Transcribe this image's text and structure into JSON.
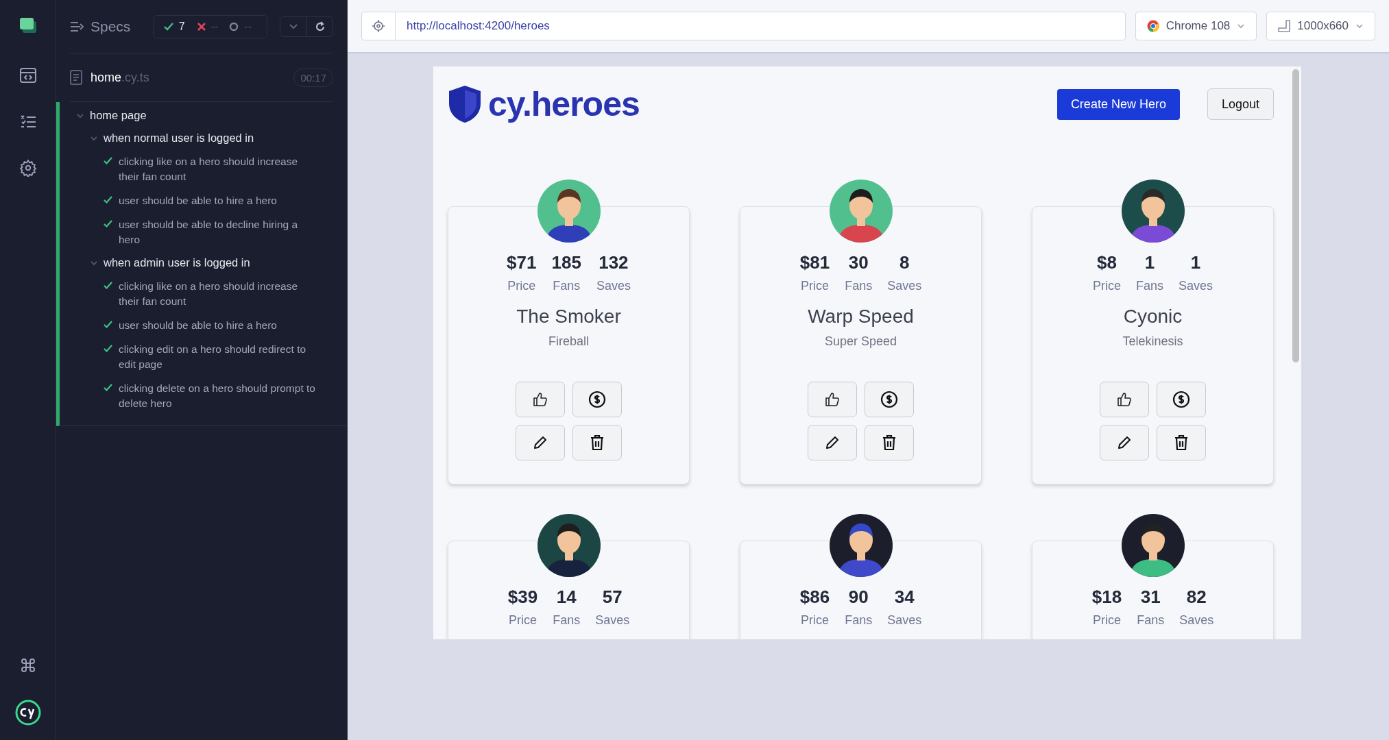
{
  "reporter": {
    "title": "Specs",
    "stats": {
      "passed": "7",
      "failed": "--",
      "pending": "--"
    },
    "spec": {
      "name": "home",
      "extension": ".cy.ts",
      "duration": "00:17"
    },
    "tree": [
      {
        "kind": "suite",
        "title": "home page",
        "expanded": true,
        "children": [
          {
            "kind": "suite",
            "title": "when normal user is logged in",
            "expanded": true,
            "children": [
              {
                "kind": "test",
                "title": "clicking like on a hero should increase their fan count",
                "passed": true
              },
              {
                "kind": "test",
                "title": "user should be able to hire a hero",
                "passed": true
              },
              {
                "kind": "test",
                "title": "user should be able to decline hiring a hero",
                "passed": true
              }
            ]
          },
          {
            "kind": "suite",
            "title": "when admin user is logged in",
            "expanded": true,
            "children": [
              {
                "kind": "test",
                "title": "clicking like on a hero should increase their fan count",
                "passed": true
              },
              {
                "kind": "test",
                "title": "user should be able to hire a hero",
                "passed": true
              },
              {
                "kind": "test",
                "title": "clicking edit on a hero should redirect to edit page",
                "passed": true
              },
              {
                "kind": "test",
                "title": "clicking delete on a hero should prompt to delete hero",
                "passed": true
              }
            ]
          }
        ]
      }
    ]
  },
  "browser_bar": {
    "url": "http://localhost:4200/heroes",
    "browser": "Chrome 108",
    "viewport": "1000x660"
  },
  "app": {
    "logo": "cy.heroes",
    "create_button": "Create New Hero",
    "logout_button": "Logout",
    "heroes": [
      {
        "color": "#52c08e",
        "stats": [
          {
            "value": "$71",
            "label": "Price"
          },
          {
            "value": "185",
            "label": "Fans"
          },
          {
            "value": "132",
            "label": "Saves"
          }
        ],
        "name": "The Smoker",
        "power": "Fireball"
      },
      {
        "color": "#52c08e",
        "stats": [
          {
            "value": "$81",
            "label": "Price"
          },
          {
            "value": "30",
            "label": "Fans"
          },
          {
            "value": "8",
            "label": "Saves"
          }
        ],
        "name": "Warp Speed",
        "power": "Super Speed"
      },
      {
        "color": "#1d4d4a",
        "stats": [
          {
            "value": "$8",
            "label": "Price"
          },
          {
            "value": "1",
            "label": "Fans"
          },
          {
            "value": "1",
            "label": "Saves"
          }
        ],
        "name": "Cyonic",
        "power": "Telekinesis"
      },
      {
        "color": "#1c4643",
        "stats": [
          {
            "value": "$39",
            "label": "Price"
          },
          {
            "value": "14",
            "label": "Fans"
          },
          {
            "value": "57",
            "label": "Saves"
          }
        ]
      },
      {
        "color": "#1c1f2b",
        "stats": [
          {
            "value": "$86",
            "label": "Price"
          },
          {
            "value": "90",
            "label": "Fans"
          },
          {
            "value": "34",
            "label": "Saves"
          }
        ]
      },
      {
        "color": "#1c1f2b",
        "stats": [
          {
            "value": "$18",
            "label": "Price"
          },
          {
            "value": "31",
            "label": "Fans"
          },
          {
            "value": "82",
            "label": "Saves"
          }
        ]
      }
    ]
  }
}
